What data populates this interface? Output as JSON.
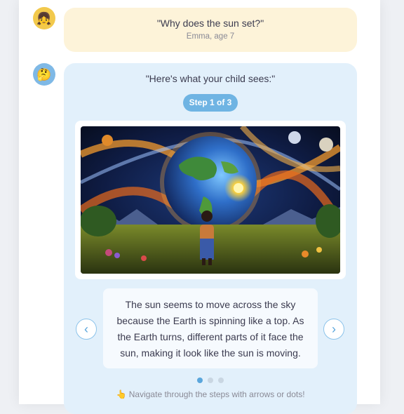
{
  "question": {
    "avatar_icon": "child-face-icon",
    "text": "\"Why does the sun set?\"",
    "byline": "Emma, age 7"
  },
  "answer": {
    "avatar_icon": "thinking-face-icon",
    "lead": "\"Here's what your child sees:\"",
    "step_badge": "Step 1 of 3",
    "illustration": "earth-and-sun-illustration",
    "explanation": "The sun seems to move across the sky because the Earth is spinning like a top. As the Earth turns, different parts of it face the sun, making it look like the sun is moving.",
    "dots": {
      "total": 3,
      "active": 1
    },
    "hint_icon": "pointing-hand-icon",
    "hint": "Navigate through the steps with arrows or dots!"
  },
  "colors": {
    "question_bubble": "#fdf3d9",
    "answer_bubble": "#e2f0fb",
    "accent": "#6fb4e3"
  }
}
